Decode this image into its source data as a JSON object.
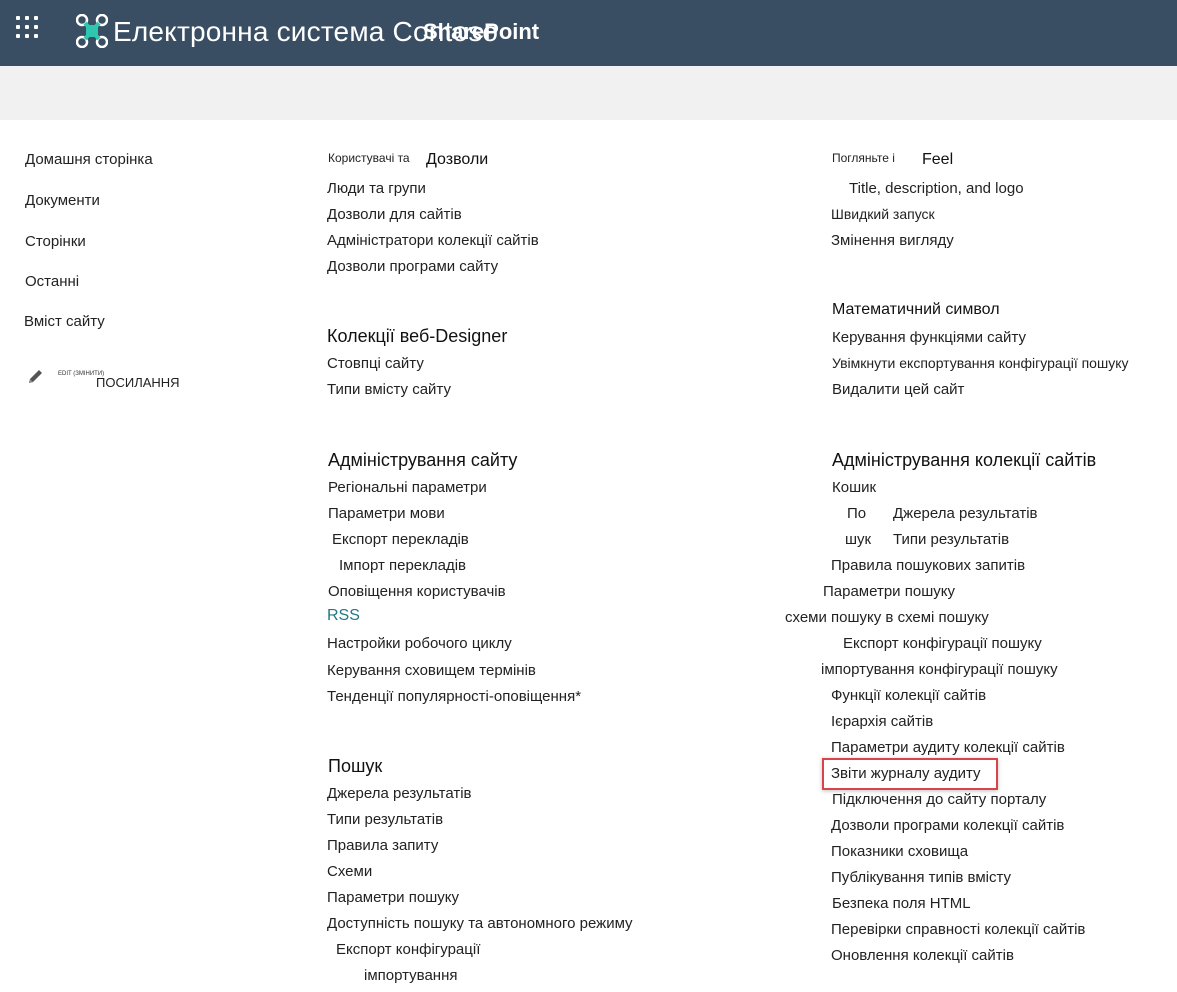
{
  "suite_bar": {
    "site_title": "Електронна система Contoso",
    "product_name": "SharePoint",
    "waffle_icon": "app-launcher-icon",
    "logo_icon": "contoso-logo-icon",
    "background": "#3a4e63"
  },
  "left_nav": {
    "items": [
      "Домашня сторінка",
      "Документи",
      "Сторінки",
      "Останні",
      "Вміст сайту"
    ],
    "edit_links_small": "EDIT (ЗМІНИТИ)",
    "edit_links_label": "ПОСИЛАННЯ",
    "edit_icon": "pencil-icon"
  },
  "sections": {
    "users": {
      "heading_small": "Користувачі та",
      "heading_big": "Дозволи",
      "links": [
        "Люди та групи",
        "Дозволи для сайтів",
        "Адміністратори колекції сайтів",
        "Дозволи програми сайту"
      ]
    },
    "web_designer": {
      "heading": "Колекції веб-Designer",
      "links": [
        "Стовпці сайту",
        "Типи вмісту сайту"
      ]
    },
    "site_admin": {
      "heading": "Адміністрування сайту",
      "links": [
        "Регіональні параметри",
        "Параметри мови",
        "Експорт перекладів",
        "Імпорт перекладів",
        "Оповіщення користувачів",
        "RSS",
        "Настройки робочого циклу",
        "Керування сховищем термінів",
        "Тенденції популярності-оповіщення*"
      ]
    },
    "search": {
      "heading": "Пошук",
      "links": [
        "Джерела результатів",
        "Типи результатів",
        "Правила запиту",
        "Схеми",
        "Параметри пошуку",
        "Доступність пошуку та автономного режиму",
        "Експорт  конфігурації",
        "імпортування"
      ]
    },
    "look_feel": {
      "heading_small": "Погляньте і",
      "heading_big": "Feel",
      "links": [
        "Title, description, and logo",
        "Швидкий запуск",
        "Змінення вигляду"
      ]
    },
    "site_actions": {
      "heading": "Математичний символ",
      "links": [
        "Керування функціями сайту",
        "Увімкнути експортування конфігурації пошуку",
        "Видалити цей сайт"
      ]
    },
    "collection_admin": {
      "heading": "Адміністрування колекції сайтів",
      "links": [
        "Кошик",
        "По",
        "Джерела результатів",
        "шук",
        "Типи результатів",
        "Правила пошукових запитів",
        "Параметри пошуку",
        "схеми пошуку в схемі пошуку",
        "Експорт конфігурації пошуку",
        "імпортування конфігурації пошуку",
        "Функції колекції сайтів",
        "Ієрархія сайтів",
        "Параметри аудиту колекції сайтів",
        "Звіти журналу аудиту",
        "Підключення до сайту порталу",
        "Дозволи програми колекції сайтів",
        "Показники сховища",
        "Публікування типів вмісту",
        "Безпека поля HTML",
        "Перевірки справності колекції сайтів",
        "Оновлення колекції сайтів"
      ]
    }
  },
  "colors": {
    "accent_link": "#1f7a86",
    "highlight_border": "#d9434a",
    "band": "#f1f1f1"
  }
}
